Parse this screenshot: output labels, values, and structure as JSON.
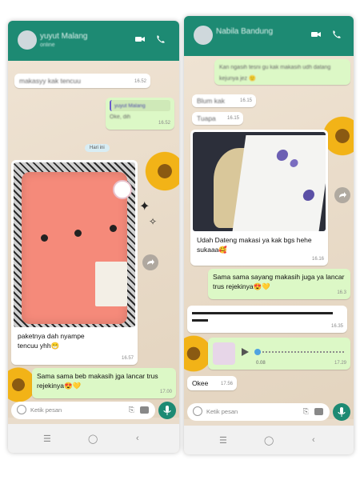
{
  "left_chat": {
    "contact_name": "yuyut Malang",
    "contact_sub": "online",
    "messages_top": [
      {
        "text": "makasyy kak tencuu",
        "time": "16.52",
        "dir": "in"
      },
      {
        "quote_name": "yuyut Malang",
        "text": "Oke, dih",
        "time": "16.52",
        "dir": "out"
      }
    ],
    "date_chip": "Hari ini",
    "photo_caption": "paketnya dah nyampe tencuu yhh😁",
    "photo_time": "16.57",
    "reply_text": "Sama sama beb makasih jga lancar trus rejekinya😍💛",
    "reply_time": "17.00",
    "input_placeholder": "Ketik pesan"
  },
  "right_chat": {
    "contact_name": "Nabila Bandung",
    "messages_top": [
      {
        "text": "Kan ngasih tesni gu kak makasih udh datang kejunya jez 🙂",
        "dir": "out"
      },
      {
        "text": "Blum kak",
        "time": "16.15",
        "dir": "in"
      },
      {
        "text": "Tuapa",
        "time": "16.15",
        "dir": "in"
      }
    ],
    "photo_caption": "Udah Dateng makasi ya kak bgs hehe sukaaa🥰",
    "photo_time": "16.16",
    "reply_text": "Sama sama sayang makasih juga ya lancar trus rejekinya😍💛",
    "reply_time": "16.3",
    "redacted_time": "16.35",
    "voice_duration": "0.08",
    "voice_time": "17.29",
    "okee_text": "Okee",
    "okee_time": "17.56",
    "input_placeholder": "Ketik pesan"
  },
  "colors": {
    "header": "#1d8a73",
    "bubble_out": "#dcf8c6",
    "bubble_in": "#ffffff",
    "wallpaper": "#e9dccb",
    "shirt_pink": "#f58a7a"
  },
  "icons": [
    "video-call-icon",
    "voice-call-icon",
    "emoji-icon",
    "attach-icon",
    "camera-icon",
    "mic-icon",
    "forward-icon",
    "play-icon",
    "back-icon",
    "home-icon",
    "recents-icon"
  ]
}
